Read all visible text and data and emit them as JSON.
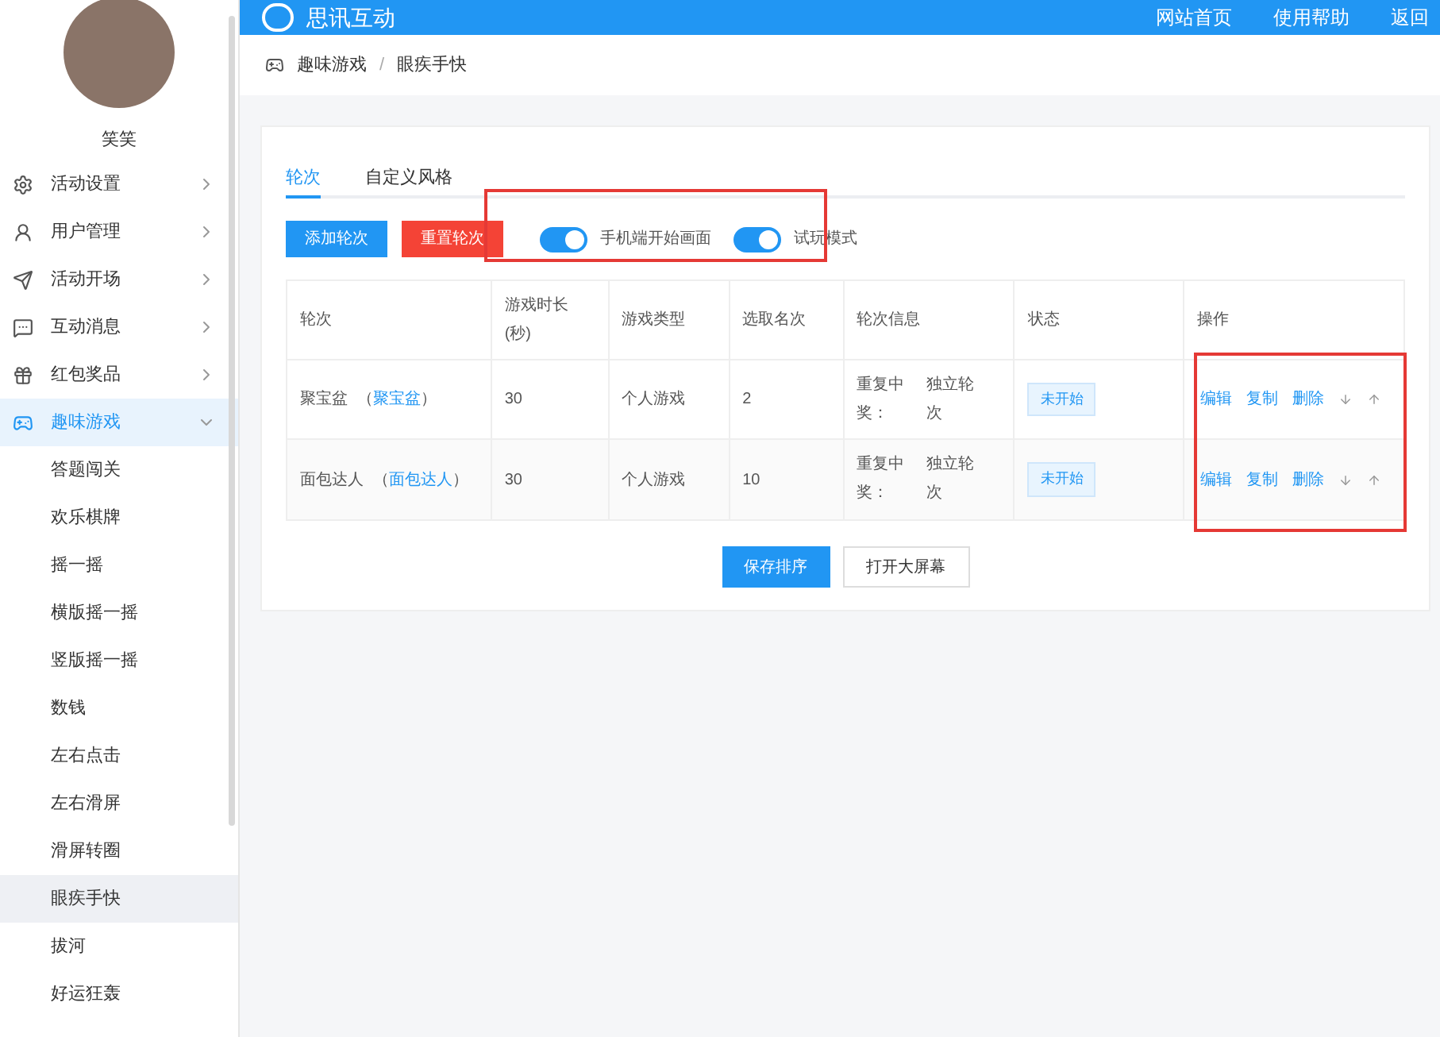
{
  "header": {
    "title": "思讯互动",
    "links": [
      "网站首页",
      "使用帮助",
      "返回"
    ]
  },
  "sidebar": {
    "user_name": "笑笑",
    "menu": [
      {
        "label": "活动设置",
        "expanded": false,
        "selected": false
      },
      {
        "label": "用户管理",
        "expanded": false,
        "selected": false
      },
      {
        "label": "活动开场",
        "expanded": false,
        "selected": false
      },
      {
        "label": "互动消息",
        "expanded": false,
        "selected": false
      },
      {
        "label": "红包奖品",
        "expanded": false,
        "selected": false
      },
      {
        "label": "趣味游戏",
        "expanded": true,
        "selected": true,
        "children": [
          {
            "label": "答题闯关",
            "selected": false
          },
          {
            "label": "欢乐棋牌",
            "selected": false
          },
          {
            "label": "摇一摇",
            "selected": false
          },
          {
            "label": "横版摇一摇",
            "selected": false
          },
          {
            "label": "竖版摇一摇",
            "selected": false
          },
          {
            "label": "数钱",
            "selected": false
          },
          {
            "label": "左右点击",
            "selected": false
          },
          {
            "label": "左右滑屏",
            "selected": false
          },
          {
            "label": "滑屏转圈",
            "selected": false
          },
          {
            "label": "眼疾手快",
            "selected": true
          },
          {
            "label": "拔河",
            "selected": false
          },
          {
            "label": "好运狂轰",
            "selected": false
          }
        ]
      }
    ]
  },
  "breadcrumb": [
    "趣味游戏",
    "/",
    "眼疾手快"
  ],
  "tabs": [
    {
      "label": "轮次",
      "selected": true
    },
    {
      "label": "自定义风格",
      "selected": false
    }
  ],
  "toolbar": {
    "add_button": "添加轮次",
    "reset_button": "重置轮次",
    "toggles": [
      {
        "label": "手机端开始画面",
        "on": true
      },
      {
        "label": "试玩模式",
        "on": true
      }
    ]
  },
  "table": {
    "columns": [
      "轮次",
      "游戏时长(秒)",
      "游戏类型",
      "选取名次",
      "轮次信息",
      "状态",
      "操作"
    ],
    "rows": [
      {
        "name": "聚宝盆",
        "link": "（聚宝盆）",
        "duration": "30",
        "type": "个人游戏",
        "rank": "2",
        "info_label": "重复中奖：",
        "info_value": "独立轮次",
        "status": "未开始",
        "actions": [
          "编辑",
          "复制",
          "删除"
        ]
      },
      {
        "name": "面包达人",
        "link": "（面包达人）",
        "duration": "30",
        "type": "个人游戏",
        "rank": "10",
        "info_label": "重复中奖：",
        "info_value": "独立轮次",
        "status": "未开始",
        "actions": [
          "编辑",
          "复制",
          "删除"
        ]
      }
    ]
  },
  "footer_buttons": {
    "save": "保存排序",
    "open": "打开大屏幕"
  }
}
